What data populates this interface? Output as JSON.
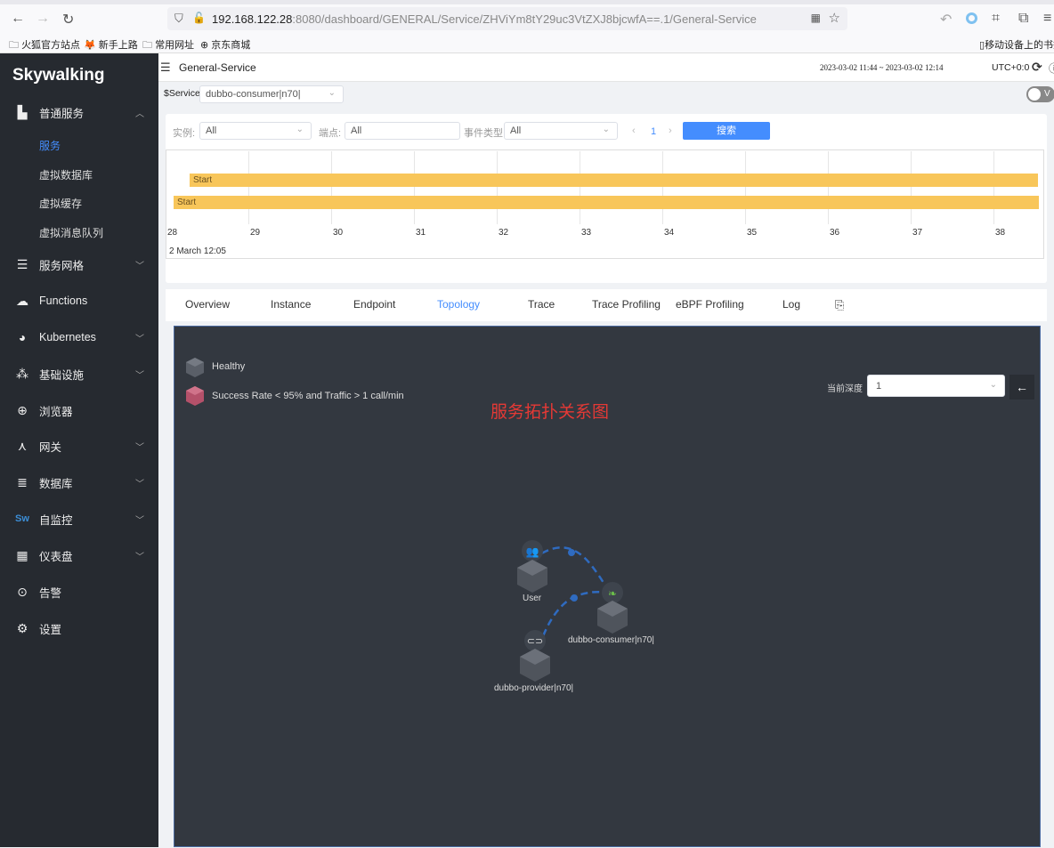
{
  "browser": {
    "url_host": "192.168.122.28",
    "url_rest": ":8080/dashboard/GENERAL/Service/ZHViYm8tY29uc3VtZXJ8bjcwfA==.1/General-Service",
    "bookmarks": [
      "火狐官方站点",
      "新手上路",
      "常用网址",
      "京东商城"
    ],
    "mobile_bookmarks": "移动设备上的书签"
  },
  "sidebar": {
    "logo": "Skywalking",
    "items": [
      {
        "label": "普通服务",
        "icon": "chart-icon",
        "expanded": true
      },
      {
        "label": "服务网格",
        "icon": "layers-icon"
      },
      {
        "label": "Functions",
        "icon": "cloud-icon"
      },
      {
        "label": "Kubernetes",
        "icon": "kubernetes-icon"
      },
      {
        "label": "基础设施",
        "icon": "nodes-icon"
      },
      {
        "label": "浏览器",
        "icon": "globe-icon"
      },
      {
        "label": "网关",
        "icon": "gateway-icon"
      },
      {
        "label": "数据库",
        "icon": "database-icon"
      },
      {
        "label": "自监控",
        "icon": "sw-icon"
      },
      {
        "label": "仪表盘",
        "icon": "dashboard-icon"
      },
      {
        "label": "告警",
        "icon": "alert-icon"
      },
      {
        "label": "设置",
        "icon": "gear-icon"
      }
    ],
    "subitems": [
      "服务",
      "虚拟数据库",
      "虚拟缓存",
      "虚拟消息队列"
    ]
  },
  "header": {
    "title": "General-Service",
    "time_range": "2023-03-02 11:44 ~ 2023-03-02 12:14",
    "timezone": "UTC+0:0",
    "toggle_label": "V"
  },
  "service_bar": {
    "label": "$Service",
    "value": "dubbo-consumer|n70|"
  },
  "events": {
    "instance_label": "实例:",
    "instance_value": "All",
    "endpoint_label": "端点:",
    "endpoint_value": "All",
    "type_label": "事件类型:",
    "type_value": "All",
    "page": "1",
    "search": "搜索",
    "bars": [
      "Start",
      "Start"
    ],
    "ticks": [
      "28",
      "29",
      "30",
      "31",
      "32",
      "33",
      "34",
      "35",
      "36",
      "37",
      "38"
    ],
    "date": "2 March 12:05"
  },
  "tabs": [
    "Overview",
    "Instance",
    "Endpoint",
    "Topology",
    "Trace",
    "Trace Profiling",
    "eBPF Profiling",
    "Log"
  ],
  "active_tab": "Topology",
  "topology": {
    "legend_healthy": "Healthy",
    "legend_unhealthy": "Success Rate < 95% and Traffic > 1 call/min",
    "annotation": "服务拓扑关系图",
    "depth_label": "当前深度",
    "depth_value": "1",
    "nodes": [
      "User",
      "dubbo-consumer|n70|",
      "dubbo-provider|n70|"
    ]
  },
  "colors": {
    "accent": "#448dfe",
    "sidebar": "#262a30",
    "topo_bg": "#333840",
    "bar": "#f8c65a",
    "annotation": "#e53935"
  }
}
